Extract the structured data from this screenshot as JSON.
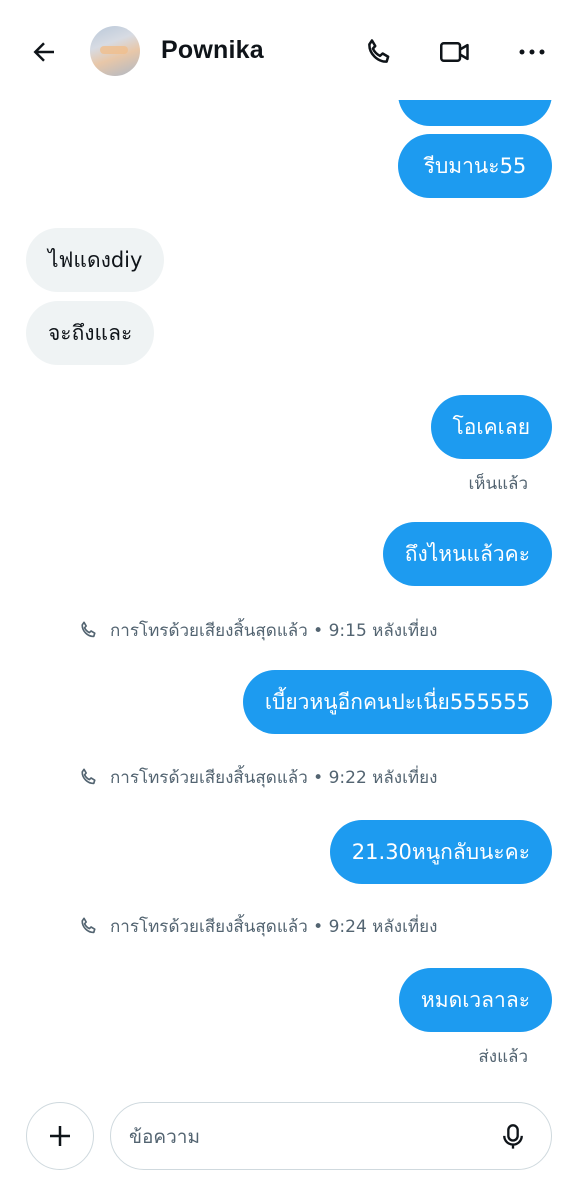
{
  "header": {
    "contact_name": "Pownika",
    "icons": {
      "back": "arrow-left-icon",
      "call": "phone-icon",
      "video": "video-camera-icon",
      "more": "more-horizontal-icon"
    }
  },
  "messages": [
    {
      "direction": "out",
      "text": ""
    },
    {
      "direction": "out",
      "text": "รีบมานะ55"
    },
    {
      "direction": "in",
      "text": "ไฟแดงdiy"
    },
    {
      "direction": "in",
      "text": "จะถึงและ"
    },
    {
      "direction": "out",
      "text": "โอเคเลย",
      "status": "เห็นแล้ว"
    },
    {
      "direction": "out",
      "text": "ถึงไหนแล้วคะ"
    },
    {
      "type": "call",
      "text": "การโทรด้วยเสียงสิ้นสุดแล้ว • 9:15 หลังเที่ยง"
    },
    {
      "direction": "out",
      "text": "เบี้ยวหนูอีกคนปะเนี่ย555555"
    },
    {
      "type": "call",
      "text": "การโทรด้วยเสียงสิ้นสุดแล้ว • 9:22 หลังเที่ยง"
    },
    {
      "direction": "out",
      "text": "21.30หนูกลับนะคะ"
    },
    {
      "type": "call",
      "text": "การโทรด้วยเสียงสิ้นสุดแล้ว • 9:24 หลังเที่ยง"
    },
    {
      "direction": "out",
      "text": "หมดเวลาละ",
      "status": "ส่งแล้ว"
    }
  ],
  "composer": {
    "placeholder": "ข้อความ",
    "value": "",
    "icons": {
      "add": "plus-icon",
      "voice": "microphone-icon"
    }
  },
  "colors": {
    "accent": "#1d9bf0",
    "incoming_bubble": "#eff3f4",
    "secondary_text": "#536471"
  }
}
